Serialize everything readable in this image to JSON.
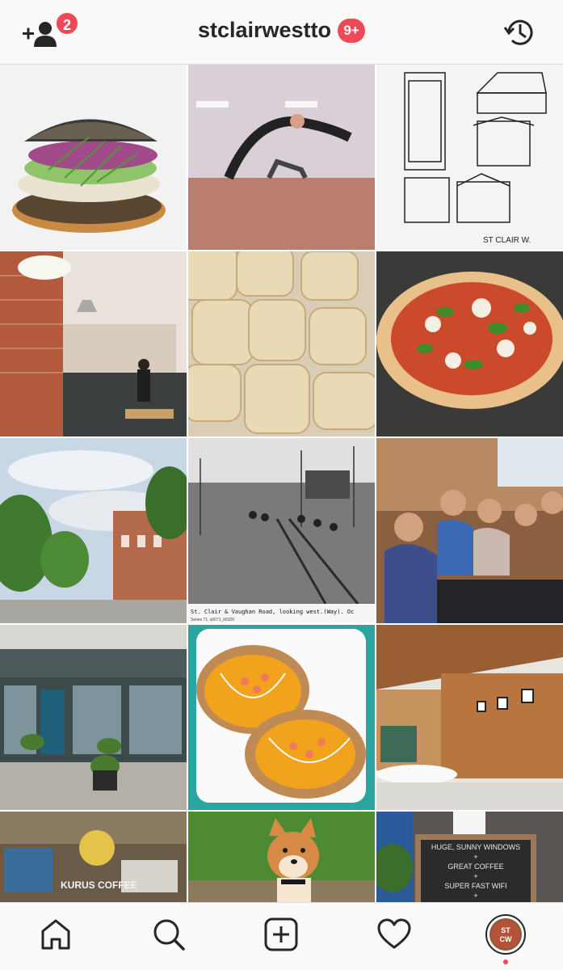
{
  "header": {
    "username": "stclairwestto",
    "add_user_badge": "2",
    "notification_badge": "9+",
    "icons": [
      "add-user-icon",
      "history-icon"
    ]
  },
  "grid": {
    "posts": [
      {
        "label": "bagel sandwich"
      },
      {
        "label": "yoga studio"
      },
      {
        "label": "street sketches",
        "sketch_label": "ST CLAIR W."
      },
      {
        "label": "cafe kitchen"
      },
      {
        "label": "scones"
      },
      {
        "label": "pizza"
      },
      {
        "label": "street and sky"
      },
      {
        "label": "historic photo",
        "caption": "St. Clair & Vaughan Road, looking west.(Way). Oc",
        "subcaption": "Series 71, s0071_it0329"
      },
      {
        "label": "friends at table"
      },
      {
        "label": "storefront"
      },
      {
        "label": "avocado toast"
      },
      {
        "label": "wood interior"
      },
      {
        "label": "coffee shop front",
        "sign": "KURUS COFFEE"
      },
      {
        "label": "shiba dog"
      },
      {
        "label": "chalkboard sign",
        "chalk_lines": [
          "HUGE, SUNNY WINDOWS",
          "+",
          "GREAT COFFEE",
          "+",
          "SUPER FAST WIFI",
          "+"
        ]
      }
    ]
  },
  "nav": {
    "items": [
      "home-icon",
      "search-icon",
      "add-post-icon",
      "activity-heart-icon",
      "profile-avatar"
    ],
    "avatar_text": "ST CW",
    "accent": "#ed4956"
  }
}
